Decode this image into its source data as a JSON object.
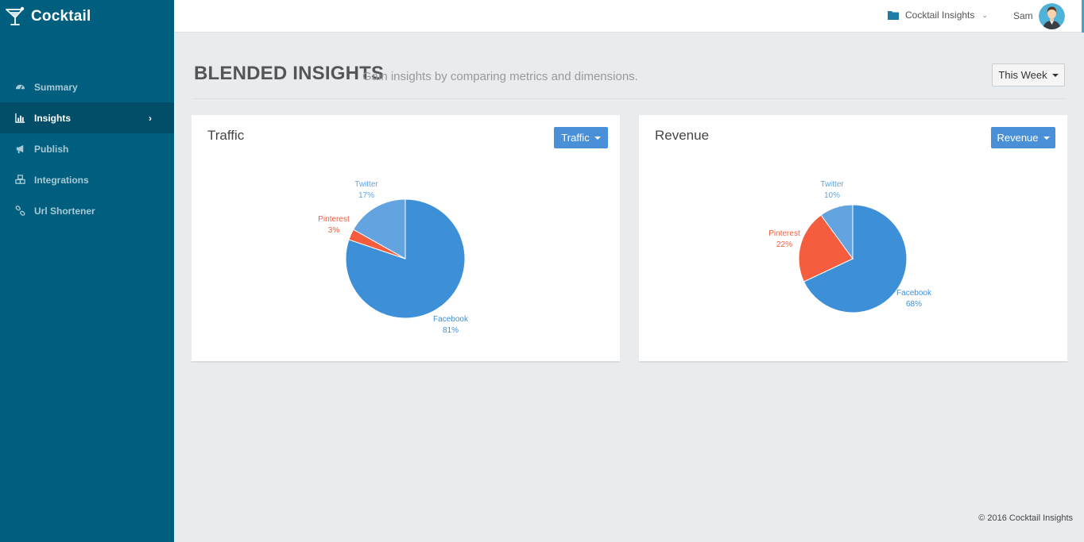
{
  "app": {
    "name": "Cocktail"
  },
  "sidebar": {
    "items": [
      {
        "label": "Summary",
        "icon": "dashboard-icon"
      },
      {
        "label": "Insights",
        "icon": "bar-chart-icon",
        "active": true
      },
      {
        "label": "Publish",
        "icon": "megaphone-icon"
      },
      {
        "label": "Integrations",
        "icon": "cubes-icon"
      },
      {
        "label": "Url Shortener",
        "icon": "link-icon"
      }
    ]
  },
  "topbar": {
    "workspace": "Cocktail Insights",
    "user": "Sam"
  },
  "page": {
    "title": "BLENDED INSIGHTS",
    "subtitle": "Gain insights by comparing metrics and dimensions.",
    "period": "This Week"
  },
  "colors": {
    "facebook": "#3d8fd8",
    "twitter": "#62a3e0",
    "pinterest": "#f55d3e",
    "sidebar": "#005f7f"
  },
  "chart_data": [
    {
      "type": "pie",
      "title": "Traffic",
      "dropdown": "Traffic",
      "slices": [
        {
          "name": "Facebook",
          "value": 81,
          "label": "81%",
          "color": "#3d8fd8"
        },
        {
          "name": "Pinterest",
          "value": 3,
          "label": "3%",
          "color": "#f55d3e"
        },
        {
          "name": "Twitter",
          "value": 17,
          "label": "17%",
          "color": "#62a3e0"
        }
      ]
    },
    {
      "type": "pie",
      "title": "Revenue",
      "dropdown": "Revenue",
      "slices": [
        {
          "name": "Facebook",
          "value": 68,
          "label": "68%",
          "color": "#3d8fd8"
        },
        {
          "name": "Pinterest",
          "value": 22,
          "label": "22%",
          "color": "#f55d3e"
        },
        {
          "name": "Twitter",
          "value": 10,
          "label": "10%",
          "color": "#62a3e0"
        }
      ]
    }
  ],
  "footer": "© 2016 Cocktail Insights"
}
